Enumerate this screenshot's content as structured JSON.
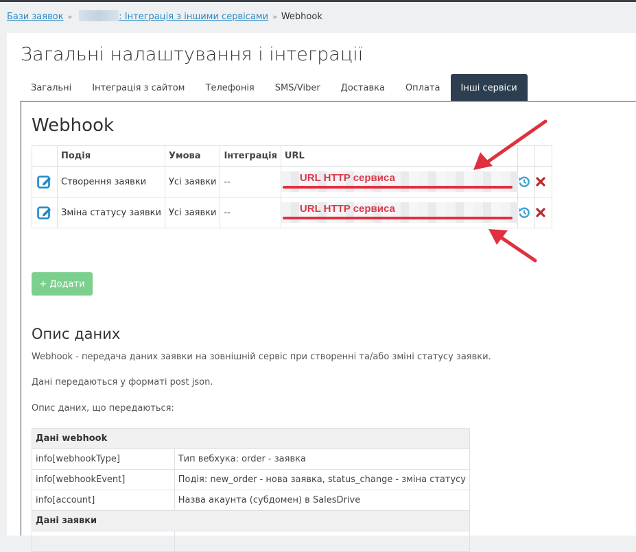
{
  "breadcrumb": {
    "root": "Бази заявок",
    "section": ": Інтеграція з іншими сервісами",
    "current": "Webhook"
  },
  "page": {
    "title": "Загальні налаштування і інтеграції"
  },
  "tabs": [
    {
      "label": "Загальні"
    },
    {
      "label": "Інтеграція з сайтом"
    },
    {
      "label": "Телефонія"
    },
    {
      "label": "SMS/Viber"
    },
    {
      "label": "Доставка"
    },
    {
      "label": "Оплата"
    },
    {
      "label": "Інші сервіси",
      "active": true
    }
  ],
  "webhook": {
    "title": "Webhook",
    "columns": {
      "event": "Подія",
      "condition": "Умова",
      "integration": "Інтеграція",
      "url": "URL"
    },
    "rows": [
      {
        "event": "Створення заявки",
        "condition": "Усі заявки",
        "integration": "--",
        "url": "URL HTTP сервиса"
      },
      {
        "event": "Зміна статусу заявки",
        "condition": "Усі заявки",
        "integration": "--",
        "url": "URL HTTP сервиса"
      }
    ],
    "add_label": "+ Додати"
  },
  "description": {
    "title": "Опис даних",
    "p1": "Webhook - передача даних заявки на зовнішній сервіс при створенні та/або зміні статусу заявки.",
    "p2": "Дані передаються у форматі post json.",
    "p3": "Опис даних, що передаються:",
    "table": {
      "group1": "Дані webhook",
      "rows": [
        {
          "key": "info[webhookType]",
          "value": "Тип вебхука: order - заявка"
        },
        {
          "key": "info[webhookEvent]",
          "value": "Подія: new_order - нова заявка, status_change - зміна статусу"
        },
        {
          "key": "info[account]",
          "value": "Назва акаунта (субдомен) в SalesDrive"
        }
      ],
      "group2": "Дані заявки"
    }
  },
  "icons": {
    "edit": "edit-icon",
    "history": "history-icon",
    "delete": "delete-icon"
  },
  "colors": {
    "accent": "#2c3e50",
    "link": "#2a8bc6",
    "edit_icon": "#1e88c7",
    "history_icon": "#3aa0d8",
    "delete_icon": "#b9282f",
    "add_button": "#7bd08e",
    "annotation": "#e0303f"
  }
}
